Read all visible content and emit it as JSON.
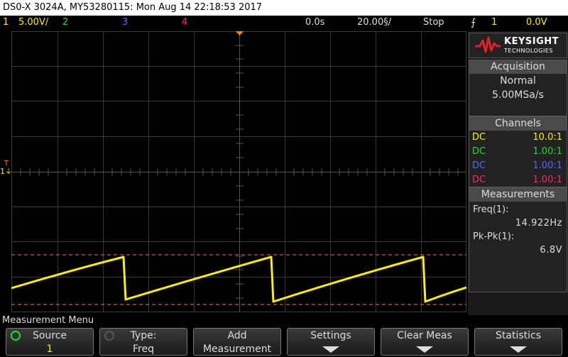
{
  "window": {
    "title": "DS0-X 3024A, MY53280115: Mon Aug 14 22:18:53 2017"
  },
  "status": {
    "ch1_num": "1",
    "ch1_scale": "5.00V/",
    "ch2_num": "2",
    "ch3_num": "3",
    "ch4_num": "4",
    "time_pos": "0.0s",
    "time_scale": "20.00§/",
    "run_state": "Stop",
    "trig_icon": "trigger-edge-icon",
    "trig_src": "1",
    "trig_level": "0.0V"
  },
  "colors": {
    "ch1": "#ffee00",
    "ch2": "#22dd22",
    "ch3": "#5566ff",
    "ch4": "#ff2277",
    "cursor": "#e07f4f",
    "grid": "#3a3a3a"
  },
  "screen": {
    "trigger_marker": "T",
    "ground_marker": "1"
  },
  "brand": {
    "name": "KEYSIGHT",
    "sub": "TECHNOLOGIES"
  },
  "acquisition": {
    "title": "Acquisition",
    "mode": "Normal",
    "rate": "5.00MSa/s"
  },
  "channels": {
    "title": "Channels",
    "rows": [
      {
        "coupling": "DC",
        "probe": "10.0:1"
      },
      {
        "coupling": "DC",
        "probe": "1.00:1"
      },
      {
        "coupling": "DC",
        "probe": "1.00:1"
      },
      {
        "coupling": "DC",
        "probe": "1.00:1"
      }
    ]
  },
  "measurements": {
    "title": "Measurements",
    "items": [
      {
        "label": "Freq(1):",
        "value": "14.922Hz"
      },
      {
        "label": "Pk-Pk(1):",
        "value": "6.8V"
      }
    ]
  },
  "menu": {
    "title": "Measurement Menu",
    "softkeys": [
      {
        "line1": "Source",
        "line2": "1",
        "icon": "rotate-knob-icon"
      },
      {
        "line1": "Type:",
        "line2": "Freq",
        "icon": "rotate-knob-icon"
      },
      {
        "line1": "Add",
        "line2": "Measurement"
      },
      {
        "line1": "Settings",
        "icon": "arrow-down-icon"
      },
      {
        "line1": "Clear Meas",
        "icon": "arrow-down-icon"
      },
      {
        "line1": "Statistics",
        "icon": "arrow-down-icon"
      }
    ]
  }
}
